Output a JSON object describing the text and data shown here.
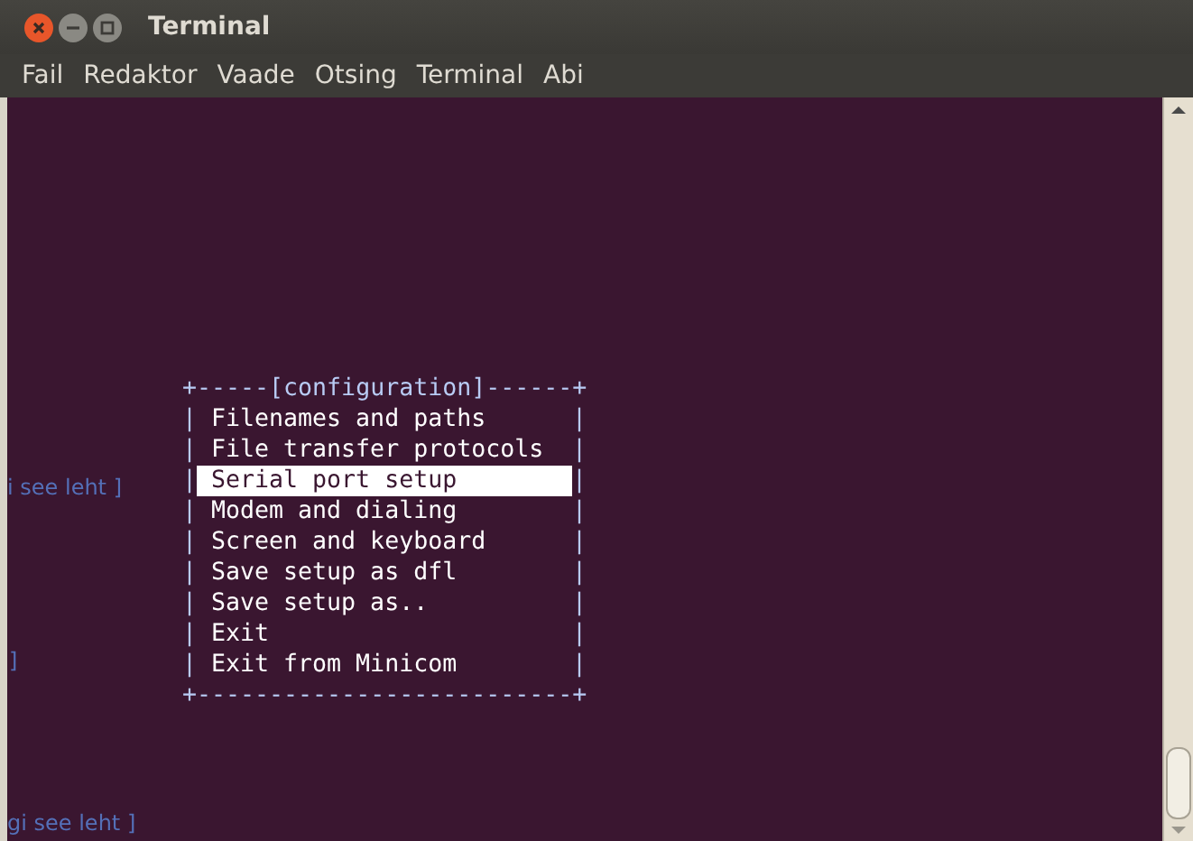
{
  "window": {
    "title": "Terminal"
  },
  "menu_bar": [
    "Fail",
    "Redaktor",
    "Vaade",
    "Otsing",
    "Terminal",
    "Abi"
  ],
  "terminal": {
    "dialog": {
      "top_border": "+-----[configuration]------+",
      "side": "|",
      "items": [
        {
          "label": "Filenames and paths",
          "selected": false
        },
        {
          "label": "File transfer protocols",
          "selected": false
        },
        {
          "label": "Serial port setup",
          "selected": true
        },
        {
          "label": "Modem and dialing",
          "selected": false
        },
        {
          "label": "Screen and keyboard",
          "selected": false
        },
        {
          "label": "Save setup as dfl",
          "selected": false
        },
        {
          "label": "Save setup as..",
          "selected": false
        },
        {
          "label": "Exit",
          "selected": false
        },
        {
          "label": "Exit from Minicom",
          "selected": false
        }
      ],
      "bottom_border": "+--------------------------+"
    }
  },
  "background_fragments": [
    "i see leht ]",
    "]",
    "gi see leht ]"
  ]
}
